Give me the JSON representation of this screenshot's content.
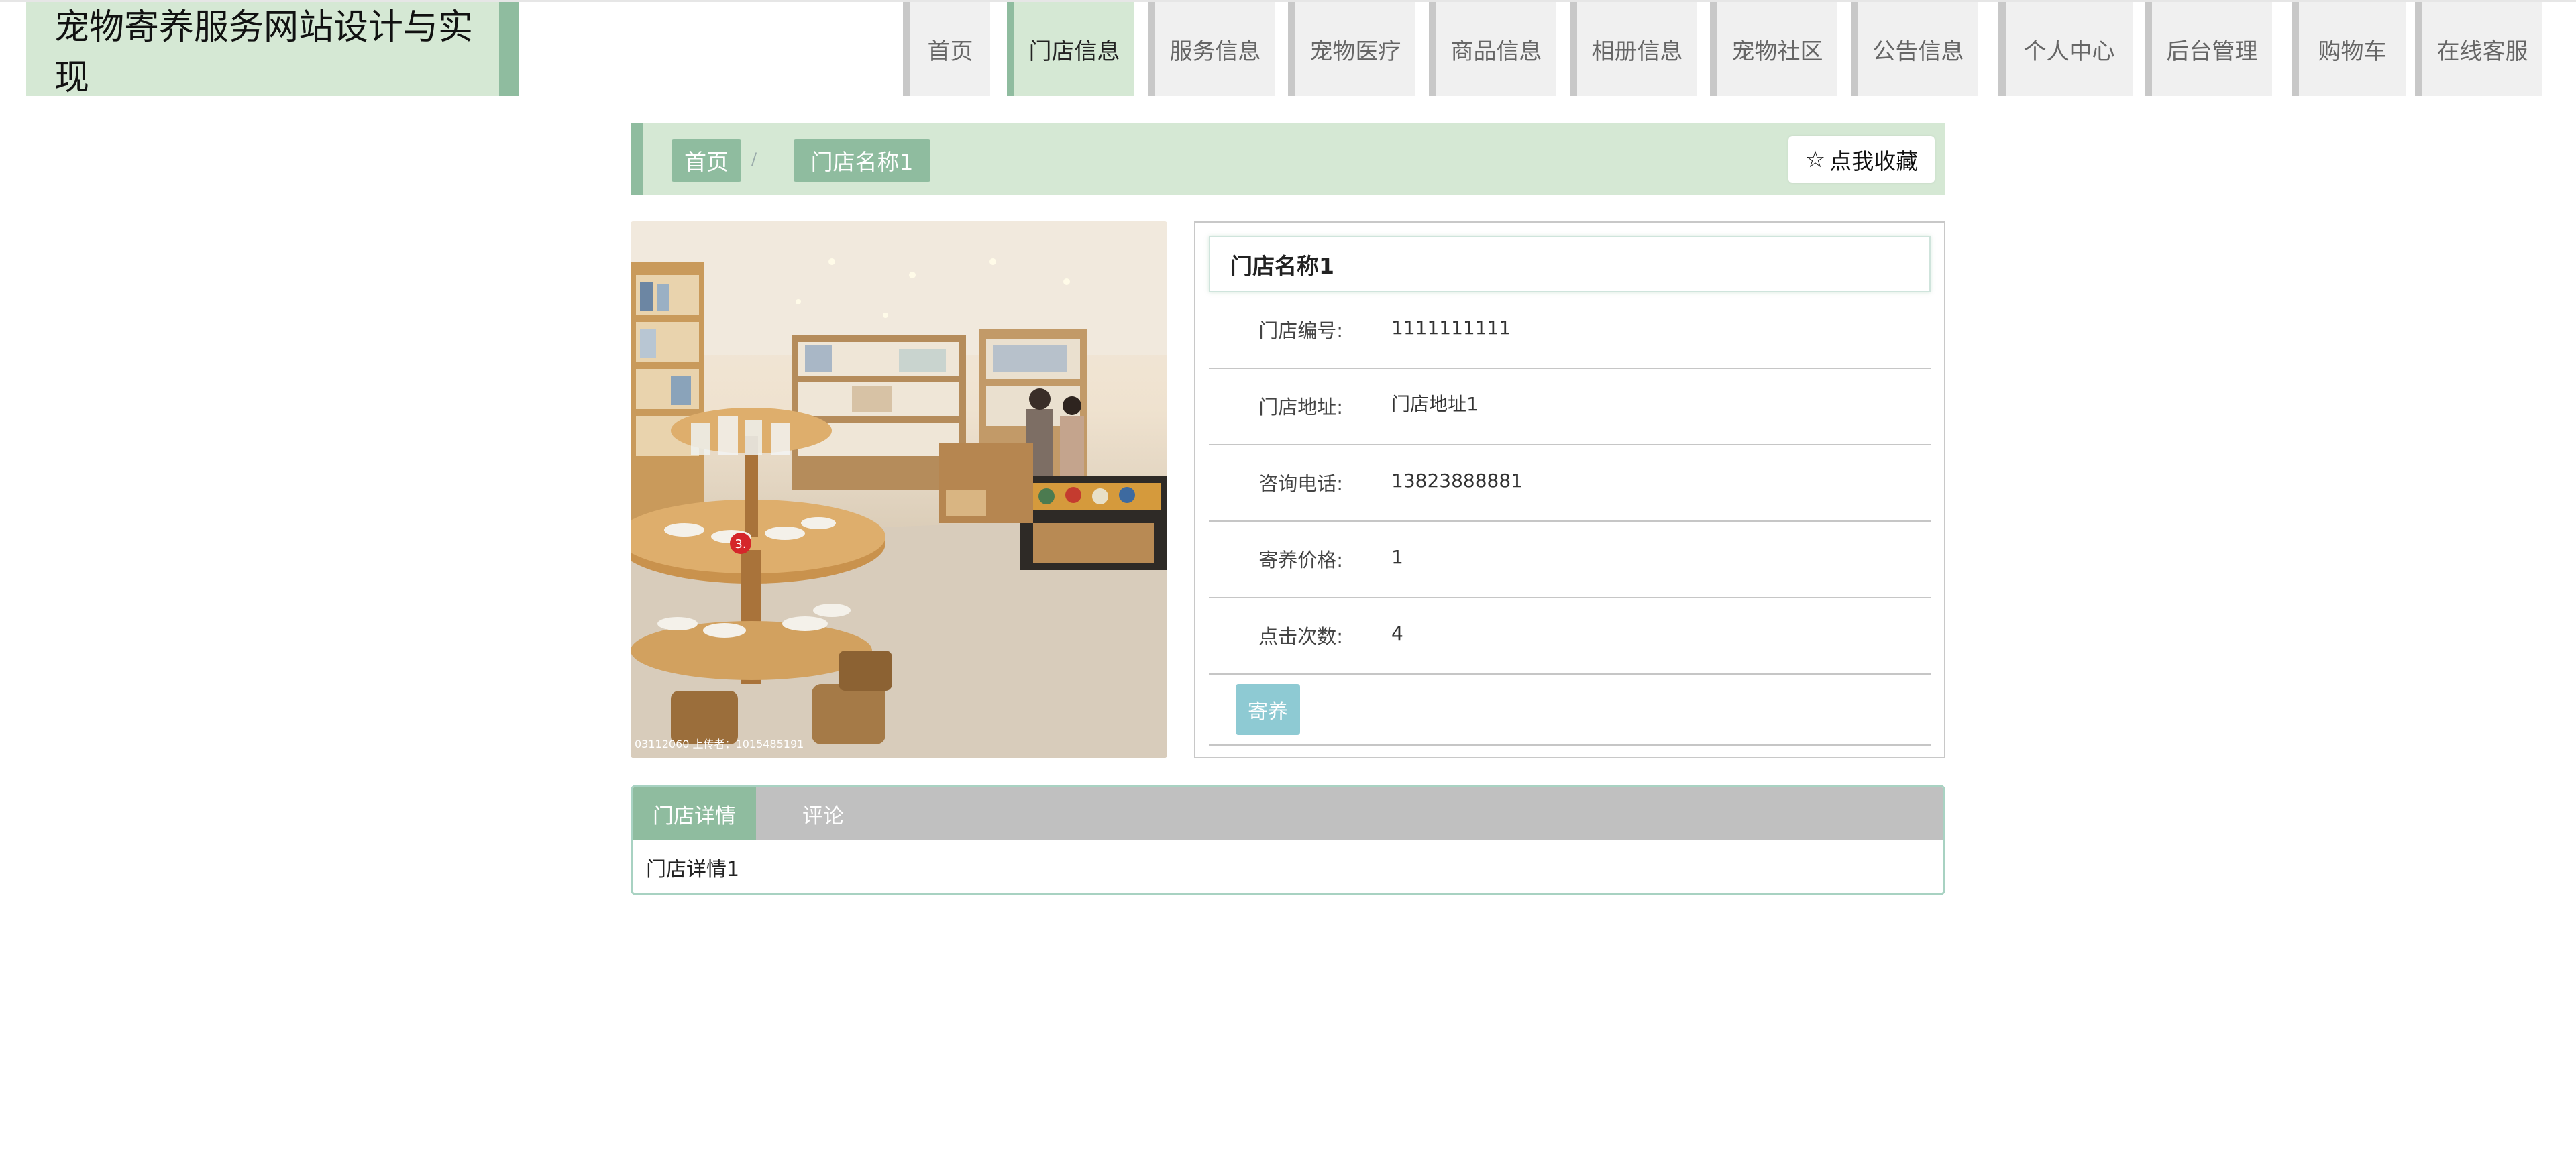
{
  "site": {
    "title": "宠物寄养服务网站设计与实现"
  },
  "nav": {
    "items": [
      {
        "label": "首页"
      },
      {
        "label": "门店信息"
      },
      {
        "label": "服务信息"
      },
      {
        "label": "宠物医疗"
      },
      {
        "label": "商品信息"
      },
      {
        "label": "相册信息"
      },
      {
        "label": "宠物社区"
      },
      {
        "label": "公告信息"
      },
      {
        "label": "个人中心"
      },
      {
        "label": "后台管理"
      },
      {
        "label": "购物车"
      },
      {
        "label": "在线客服"
      }
    ],
    "active_label": "门店信息"
  },
  "breadcrumb": {
    "home": "首页",
    "separator": "/",
    "current": "门店名称1",
    "favorite_label": "点我收藏"
  },
  "image": {
    "badge": "3.",
    "watermark_text": "03112060  上传者：1015485191"
  },
  "store": {
    "name": "门店名称1",
    "fields": [
      {
        "label": "门店编号:",
        "value": "1111111111"
      },
      {
        "label": "门店地址:",
        "value": "门店地址1"
      },
      {
        "label": "咨询电话:",
        "value": "13823888881"
      },
      {
        "label": "寄养价格:",
        "value": "1"
      },
      {
        "label": "点击次数:",
        "value": "4"
      }
    ],
    "action_label": "寄养"
  },
  "tabs": {
    "items": [
      {
        "label": "门店详情"
      },
      {
        "label": "评论"
      }
    ],
    "active_label": "门店详情",
    "content": "门店详情1"
  },
  "colors": {
    "accent": "#8fbc9f",
    "accent_light": "#d5e8d4",
    "button": "#8ecad3",
    "tab_bar": "#c0c0c0"
  }
}
